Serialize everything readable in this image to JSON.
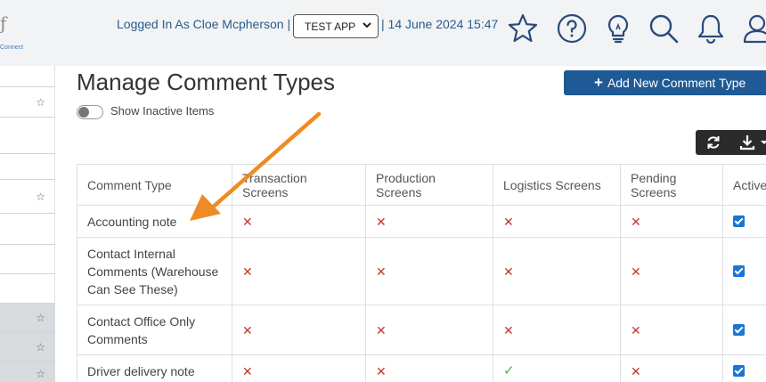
{
  "header": {
    "logo_text": "Connect",
    "logged_in": "Logged In As Cloe Mcpherson",
    "separator": "|",
    "app_select": "TEST APP",
    "date_text": "| 14 June 2024 15:47",
    "icons": [
      "star-icon",
      "help-icon",
      "lightbulb-icon",
      "search-icon",
      "bell-icon",
      "user-icon"
    ]
  },
  "sidebar": {
    "items": [
      {
        "star": "☆"
      },
      {
        "star": ""
      },
      {
        "star": ""
      },
      {
        "star": "☆"
      },
      {
        "star": ""
      },
      {
        "star": ""
      },
      {
        "star": ""
      },
      {
        "star": "☆"
      },
      {
        "star": "☆"
      },
      {
        "star": "☆"
      }
    ]
  },
  "page": {
    "title": "Manage Comment Types",
    "toggle_label": "Show Inactive Items",
    "add_button": "Add New Comment Type",
    "add_button_icon": "+",
    "toolbar_icons": [
      "refresh-icon",
      "download-icon"
    ]
  },
  "table": {
    "headers": [
      "Comment Type",
      "Transaction Screens",
      "Production Screens",
      "Logistics Screens",
      "Pending Screens",
      "Active"
    ],
    "rows": [
      {
        "name": "Accounting note",
        "cells": [
          "✕",
          "✕",
          "✕",
          "✕"
        ],
        "active": true
      },
      {
        "name": "Contact Internal Comments (Warehouse Can See These)",
        "cells": [
          "✕",
          "✕",
          "✕",
          "✕"
        ],
        "active": true
      },
      {
        "name": "Contact Office Only Comments",
        "cells": [
          "✕",
          "✕",
          "✕",
          "✕"
        ],
        "active": true
      },
      {
        "name": "Driver delivery note",
        "cells": [
          "✕",
          "✕",
          "✓",
          "✕"
        ],
        "active": true
      }
    ]
  },
  "colors": {
    "accent": "#1f5a96",
    "cross": "#c0392b",
    "check": "#4caf50",
    "arrow": "#f08a24"
  }
}
